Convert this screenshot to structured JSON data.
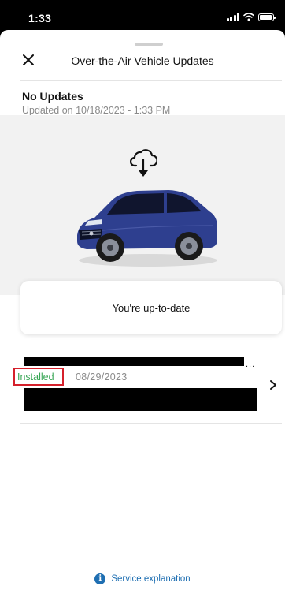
{
  "status_bar": {
    "time": "1:33"
  },
  "header": {
    "title": "Over-the-Air Vehicle Updates",
    "close_icon": "close-icon"
  },
  "update_status": {
    "title": "No Updates",
    "subtitle": "Updated on 10/18/2023 - 1:33 PM"
  },
  "hero": {
    "icon": "cloud-download-icon",
    "car_color": "#2e3f8f"
  },
  "uptodate_card": {
    "text": "You're up-to-date"
  },
  "history_item": {
    "title_ellipsis": "...",
    "status": "Installed",
    "status_color": "#3aa757",
    "date": "08/29/2023",
    "chevron": "chevron-right-icon"
  },
  "footer": {
    "link_label": "Service explanation",
    "icon": "info-icon",
    "accent": "#1f6fb2"
  }
}
